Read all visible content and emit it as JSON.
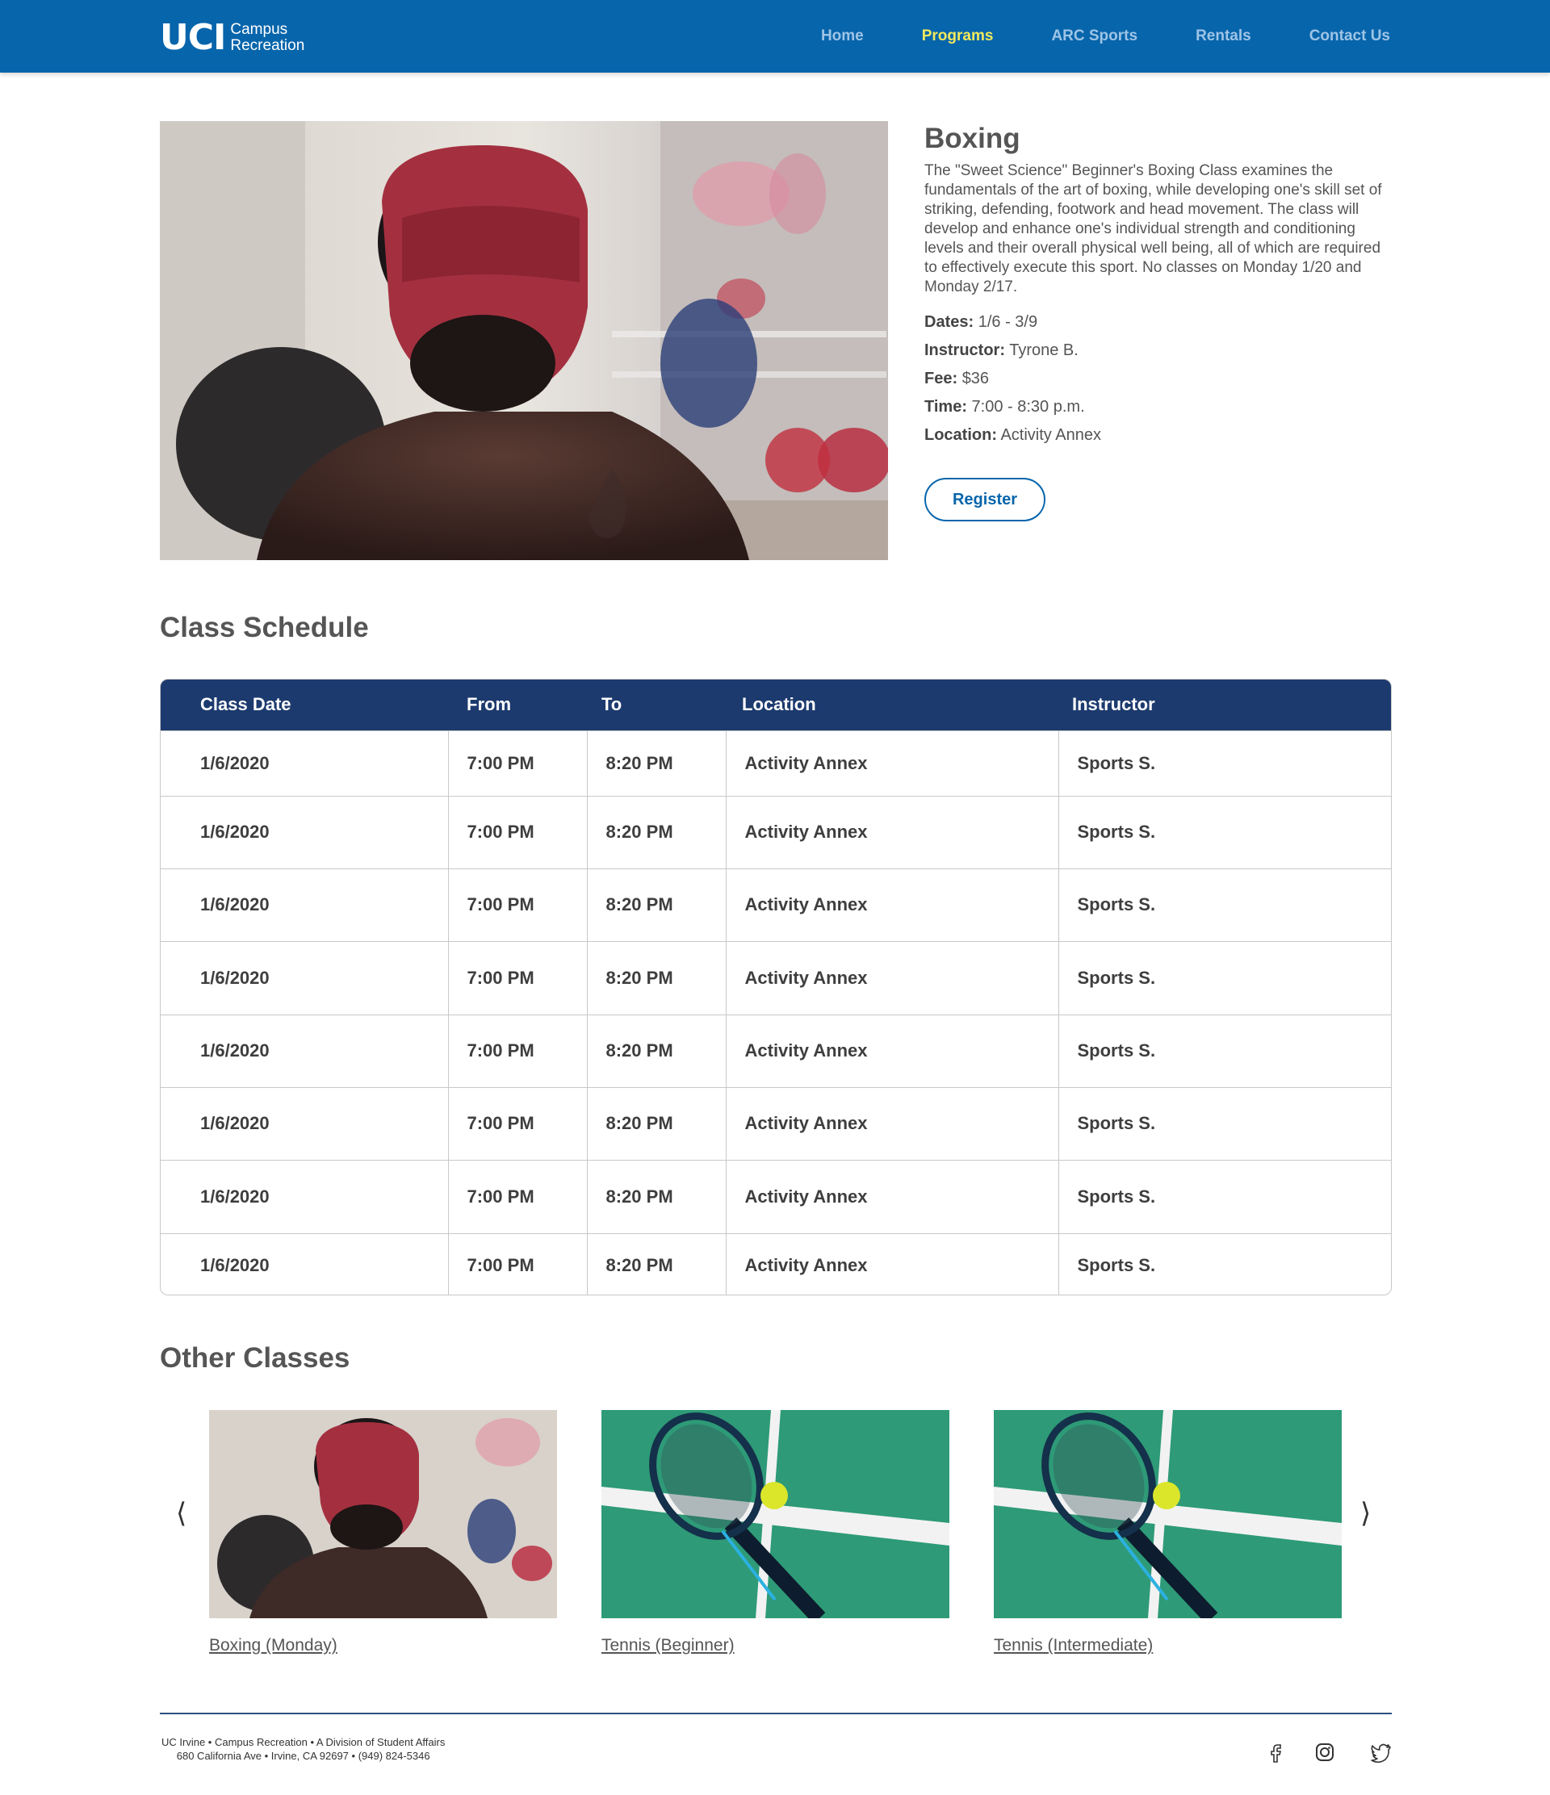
{
  "header": {
    "logo_main": "UCI",
    "logo_line1": "Campus",
    "logo_line2": "Recreation",
    "nav": [
      {
        "label": "Home"
      },
      {
        "label": "Programs"
      },
      {
        "label": "ARC Sports"
      },
      {
        "label": "Rentals"
      },
      {
        "label": "Contact Us"
      }
    ],
    "active_nav": "Programs",
    "colors": {
      "bar": "#0765ab",
      "active": "#f2e95c",
      "inactive": "#9ec4e6"
    }
  },
  "program": {
    "title": "Boxing",
    "description": "The \"Sweet Science\" Beginner's Boxing Class examines the fundamentals of the art of boxing, while developing one's skill set of striking, defending, footwork and head movement. The class will develop and enhance one's individual strength and conditioning levels and their overall physical well being, all of which are required to effectively execute this sport. No classes on Monday 1/20 and Monday 2/17.",
    "details": [
      {
        "label": "Dates:",
        "value": "1/6 - 3/9"
      },
      {
        "label": "Instructor:",
        "value": "Tyrone B."
      },
      {
        "label": "Fee:",
        "value": "$36"
      },
      {
        "label": "Time:",
        "value": "7:00 - 8:30 p.m."
      },
      {
        "label": "Location:",
        "value": "Activity Annex"
      }
    ],
    "register_label": "Register"
  },
  "schedule": {
    "title": "Class Schedule",
    "columns": [
      "Class Date",
      "From",
      "To",
      "Location",
      "Instructor"
    ],
    "rows": [
      [
        "1/6/2020",
        "7:00 PM",
        "8:20 PM",
        "Activity Annex",
        "Sports S."
      ],
      [
        "1/6/2020",
        "7:00 PM",
        "8:20 PM",
        "Activity Annex",
        "Sports S."
      ],
      [
        "1/6/2020",
        "7:00 PM",
        "8:20 PM",
        "Activity Annex",
        "Sports S."
      ],
      [
        "1/6/2020",
        "7:00 PM",
        "8:20 PM",
        "Activity Annex",
        "Sports S."
      ],
      [
        "1/6/2020",
        "7:00 PM",
        "8:20 PM",
        "Activity Annex",
        "Sports S."
      ],
      [
        "1/6/2020",
        "7:00 PM",
        "8:20 PM",
        "Activity Annex",
        "Sports S."
      ],
      [
        "1/6/2020",
        "7:00 PM",
        "8:20 PM",
        "Activity Annex",
        "Sports S."
      ],
      [
        "1/6/2020",
        "7:00 PM",
        "8:20 PM",
        "Activity Annex",
        "Sports S."
      ]
    ]
  },
  "other_classes": {
    "title": "Other Classes",
    "prev_icon": "chevron-left-icon",
    "next_icon": "chevron-right-icon",
    "cards": [
      {
        "label": "Boxing (Monday)",
        "image": "boxing-photo"
      },
      {
        "label": "Tennis (Beginner)",
        "image": "tennis-photo"
      },
      {
        "label": "Tennis (Intermediate)",
        "image": "tennis-photo"
      }
    ]
  },
  "footer": {
    "line1": "UC Irvine • Campus Recreation • A Division of Student Affairs",
    "line2": "680 California Ave • Irvine, CA 92697 • (949) 824-5346",
    "social": [
      "facebook-icon",
      "instagram-icon",
      "twitter-icon"
    ]
  }
}
